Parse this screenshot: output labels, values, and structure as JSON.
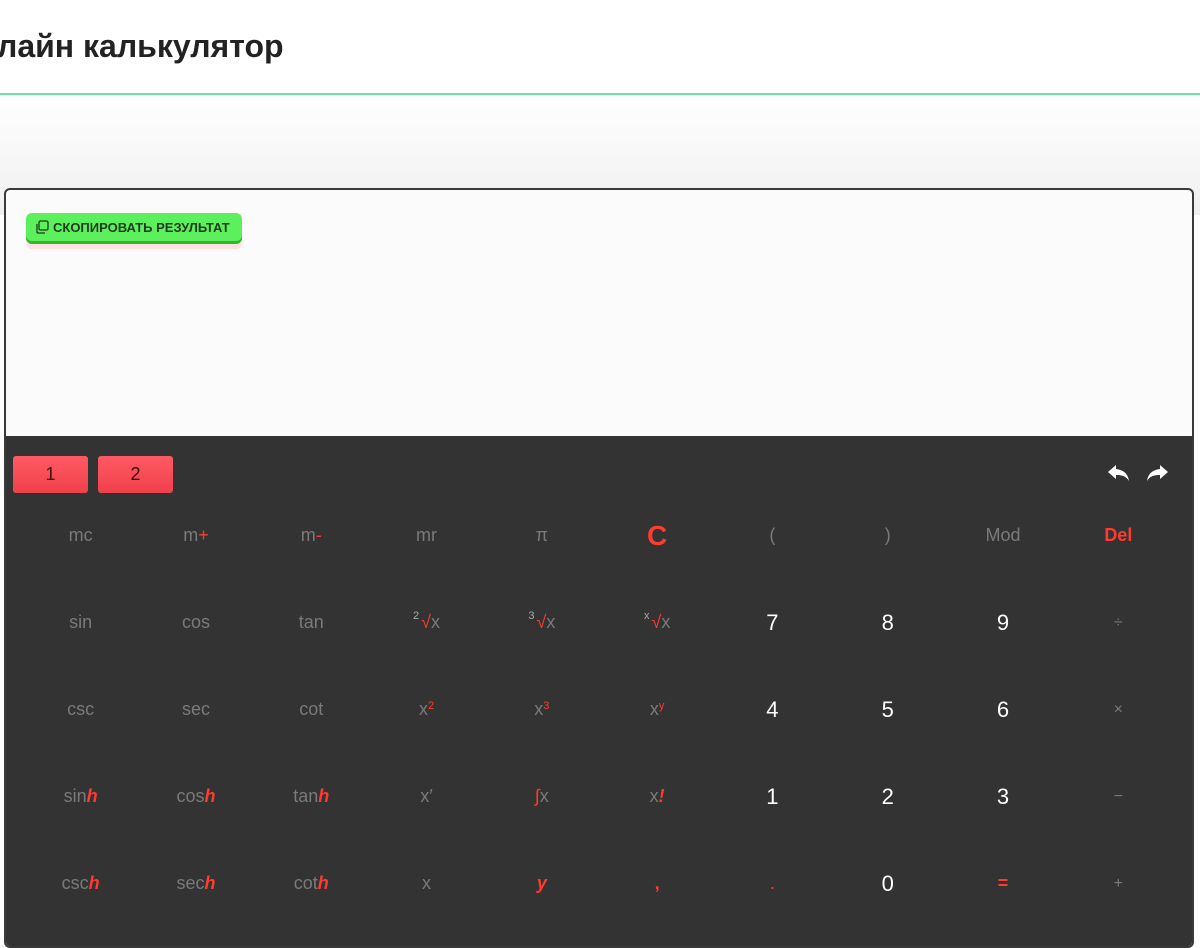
{
  "header": {
    "title": "лайн калькулятор"
  },
  "copy_button": {
    "label": "СКОПИРОВАТЬ РЕЗУЛЬТАТ",
    "icon": "copy-icon"
  },
  "display": {
    "value": ""
  },
  "modes": [
    "1",
    "2"
  ],
  "history": {
    "undo_icon": "undo-arrow-icon",
    "redo_icon": "redo-arrow-icon"
  },
  "keys": {
    "mc": "mc",
    "m_plus_a": "m",
    "m_plus_b": "+",
    "m_minus_a": "m",
    "m_minus_b": "-",
    "mr": "mr",
    "pi": "π",
    "clear": "C",
    "lparen": "(",
    "rparen": ")",
    "mod": "Mod",
    "del": "Del",
    "sin": "sin",
    "cos": "cos",
    "tan": "tan",
    "sqrt2_pre": "2",
    "sqrt3_pre": "3",
    "sqrtx_pre": "x",
    "radical": "√",
    "x": "x",
    "seven": "7",
    "eight": "8",
    "nine": "9",
    "divide": "÷",
    "csc": "csc",
    "sec": "sec",
    "cot": "cot",
    "sq_sup": "2",
    "cube_sup": "3",
    "pow_sup": "y",
    "four": "4",
    "five": "5",
    "six": "6",
    "multiply": "×",
    "sinh_a": "sin",
    "cosh_a": "cos",
    "tanh_a": "tan",
    "h": "h",
    "deriv": "x′",
    "integral_sign": "∫",
    "fact_bang": "!",
    "one": "1",
    "two": "2",
    "three": "3",
    "minus": "−",
    "csch_a": "csc",
    "sech_a": "sec",
    "coth_a": "cot",
    "y": "y",
    "comma": ",",
    "dot": ".",
    "zero": "0",
    "equals": "=",
    "plus": "+"
  },
  "colors": {
    "accent": "#ff3b2f",
    "keypad_bg": "#333333",
    "copy_green": "#5df05d",
    "rule_green": "#6ee0a8"
  }
}
